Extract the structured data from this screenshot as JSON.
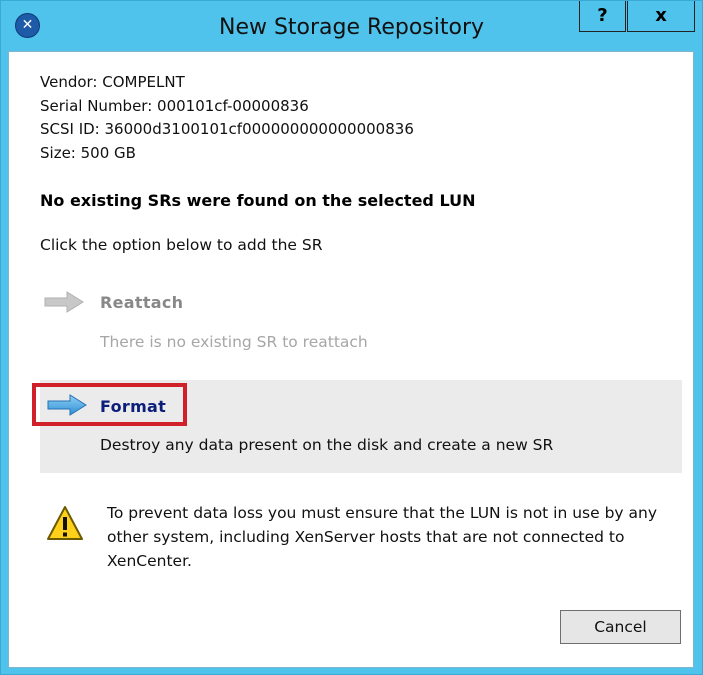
{
  "window": {
    "title": "New Storage Repository",
    "help_label": "?",
    "close_label": "x"
  },
  "lun_info": {
    "vendor": "Vendor: COMPELNT",
    "serial": "Serial Number: 000101cf-00000836",
    "scsi_id": "SCSI ID: 36000d3100101cf000000000000000836",
    "size": "Size: 500 GB"
  },
  "heading": "No existing SRs were found on the selected LUN",
  "instruction": "Click the option below to add the SR",
  "options": [
    {
      "label": "Reattach",
      "description": "There is no existing SR to reattach",
      "enabled": false,
      "icon": "arrow-right-icon"
    },
    {
      "label": "Format",
      "description": "Destroy any data present on the disk and create a new SR",
      "enabled": true,
      "selected": true,
      "icon": "arrow-right-icon"
    }
  ],
  "warning": {
    "icon": "warning-icon",
    "text": "To prevent data loss you must ensure that the LUN is not in use by any other system, including XenServer hosts that are not connected to XenCenter."
  },
  "buttons": {
    "cancel": "Cancel"
  },
  "colors": {
    "titlebar": "#4fc3eb",
    "highlight": "#d0202a",
    "format_label": "#0a1e7a",
    "disabled_text": "#a6a6a6"
  }
}
